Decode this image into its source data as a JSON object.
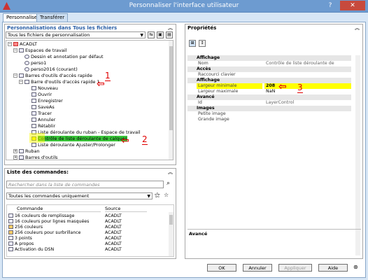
{
  "window": {
    "title": "Personnaliser l'interface utilisateur",
    "help": "?",
    "close": "✕"
  },
  "tabs": [
    {
      "label": "Personnaliser"
    },
    {
      "label": "Transférer"
    }
  ],
  "left_panel": {
    "title": "Personnalisations dans Tous les fichiers",
    "file_filter": "Tous les fichiers de personnalisation",
    "tree": [
      {
        "label": "ACADLT",
        "depth": 0
      },
      {
        "label": "Espaces de travail",
        "depth": 1
      },
      {
        "label": "Dessin et annotation par défaut",
        "depth": 2
      },
      {
        "label": "perso1",
        "depth": 2
      },
      {
        "label": "perso2016 (courant)",
        "depth": 2
      },
      {
        "label": "Barres d'outils d'accès rapide",
        "depth": 1
      },
      {
        "label": "Barre d'outils d'accès rapide 1",
        "depth": 2
      },
      {
        "label": "Nouveau",
        "depth": 3
      },
      {
        "label": "Ouvrir",
        "depth": 3
      },
      {
        "label": "Enregistrer",
        "depth": 3
      },
      {
        "label": "SaveAs",
        "depth": 3
      },
      {
        "label": "Tracer",
        "depth": 3
      },
      {
        "label": "Annuler",
        "depth": 3
      },
      {
        "label": "Rétablir",
        "depth": 3
      },
      {
        "label": "Liste déroulante du ruban - Espace de travail",
        "depth": 3
      },
      {
        "label": "Contrôle de liste déroulante de calques",
        "depth": 3,
        "selected": true
      },
      {
        "label": "Liste déroulante Ajuster/Prolonger",
        "depth": 3
      },
      {
        "label": "Ruban",
        "depth": 1
      },
      {
        "label": "Barres d'outils",
        "depth": 1
      }
    ]
  },
  "commands": {
    "title": "Liste des commandes:",
    "search_placeholder": "Rechercher dans la liste de commandes",
    "filter": "Toutes les commandes uniquement",
    "col_command": "Commande",
    "col_source": "Source",
    "rows": [
      {
        "name": "16 couleurs de remplissage",
        "source": "ACADLT"
      },
      {
        "name": "16 couleurs pour lignes masquées",
        "source": "ACADLT"
      },
      {
        "name": "256 couleurs",
        "source": "ACADLT"
      },
      {
        "name": "256 couleurs pour surbrillance",
        "source": "ACADLT"
      },
      {
        "name": "3 points",
        "source": "ACADLT"
      },
      {
        "name": "A propos",
        "source": "ACADLT"
      },
      {
        "name": "Activation du DSN",
        "source": "ACADLT"
      }
    ]
  },
  "properties": {
    "title": "Propriétés",
    "rows": [
      {
        "type": "cat",
        "name": "Affichage"
      },
      {
        "type": "prop",
        "name": "Nom",
        "value": "Contrôle de liste déroulante de calques"
      },
      {
        "type": "cat",
        "name": "Accès"
      },
      {
        "type": "prop",
        "name": "Raccourci clavier",
        "value": ""
      },
      {
        "type": "cat",
        "name": "Affichage"
      },
      {
        "type": "prop",
        "name": "Largeur minimale",
        "value": "208",
        "highlight": true
      },
      {
        "type": "prop",
        "name": "Largeur maximale",
        "value": "NaN"
      },
      {
        "type": "cat",
        "name": "Avancé"
      },
      {
        "type": "prop",
        "name": "Id",
        "value": "LayerControl"
      },
      {
        "type": "cat",
        "name": "Images"
      },
      {
        "type": "prop",
        "name": "Petite image",
        "value": ""
      },
      {
        "type": "prop",
        "name": "Grande image",
        "value": ""
      }
    ],
    "desc_title": "Avancé"
  },
  "annotations": [
    "1",
    "2",
    "3"
  ],
  "buttons": {
    "ok": "OK",
    "cancel": "Annuler",
    "apply": "Appliquer",
    "help": "Aide"
  },
  "colors": {
    "title_bar": "#6d9bd0",
    "highlight": "#ffff00",
    "selection": "#39c639",
    "annotation": "#e00000"
  }
}
